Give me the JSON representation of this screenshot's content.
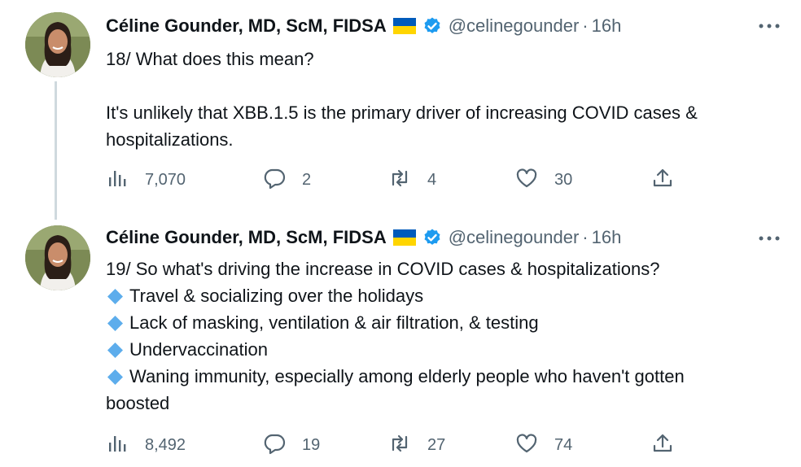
{
  "tweets": [
    {
      "author": {
        "name": "Céline Gounder, MD, ScM, FIDSA",
        "handle": "@celinegounder",
        "badge_icons": [
          "ukraine-flag-icon",
          "verified-badge-icon"
        ]
      },
      "separator": "·",
      "time": "16h",
      "text_lines": [
        "18/ What does this mean?",
        "It's unlikely that XBB.1.5 is the primary driver of increasing COVID cases &",
        "hospitalizations."
      ],
      "stats": {
        "views": "7,070",
        "replies": "2",
        "retweets": "4",
        "likes": "30"
      }
    },
    {
      "author": {
        "name": "Céline Gounder, MD, ScM, FIDSA",
        "handle": "@celinegounder",
        "badge_icons": [
          "ukraine-flag-icon",
          "verified-badge-icon"
        ]
      },
      "separator": "·",
      "time": "16h",
      "text_lines": [
        "19/ So what's driving the increase in COVID cases & hospitalizations?"
      ],
      "bullets": [
        "Travel & socializing over the holidays",
        "Lack of masking, ventilation & air filtration, & testing",
        "Undervaccination",
        "Waning immunity, especially among elderly people who haven't gotten"
      ],
      "continuation": "boosted",
      "stats": {
        "views": "8,492",
        "replies": "19",
        "retweets": "27",
        "likes": "74"
      }
    }
  ],
  "colors": {
    "text": "#0f1419",
    "secondary": "#536471",
    "verified_blue": "#1d9bf0",
    "bullet_blue": "#5dadec",
    "flag_blue": "#005bbb",
    "flag_yellow": "#ffd500",
    "thread_line": "#cfd9de"
  },
  "icons": {
    "views": "bar-chart-icon",
    "reply": "speech-bubble-icon",
    "retweet": "retweet-arrows-icon",
    "like": "heart-icon",
    "share": "share-upload-icon",
    "more": "more-dots-icon",
    "bullet": "blue-diamond-icon"
  }
}
